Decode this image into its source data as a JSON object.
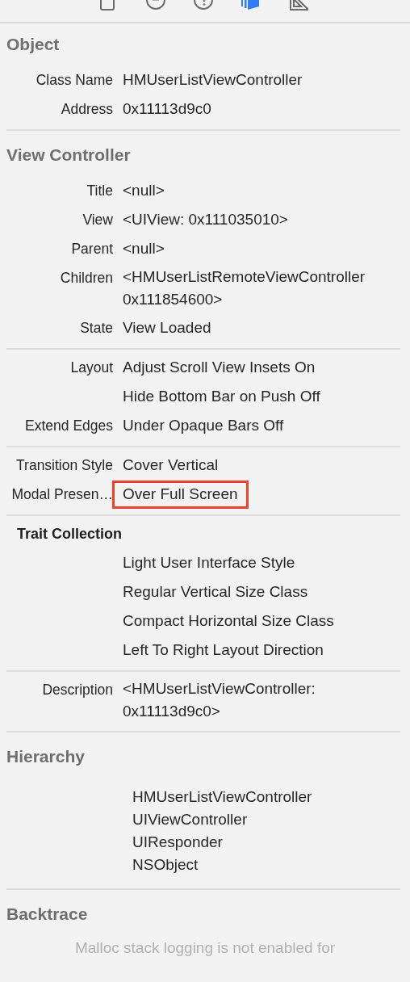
{
  "toolbar": [
    {
      "kind": "file",
      "selected": false
    },
    {
      "kind": "history",
      "selected": false
    },
    {
      "kind": "help",
      "selected": false
    },
    {
      "kind": "identity",
      "selected": true
    },
    {
      "kind": "ruler",
      "selected": false
    }
  ],
  "sections": [
    {
      "title": "Object",
      "groups": [
        {
          "rows": [
            {
              "label": "Class Name",
              "value": "HMUserListViewController",
              "highlighted": false
            },
            {
              "label": "Address",
              "value": "0x11113d9c0",
              "highlighted": false
            }
          ]
        }
      ]
    },
    {
      "title": "View Controller",
      "groups": [
        {
          "rows": [
            {
              "label": "Title",
              "value": "<null>",
              "highlighted": false
            },
            {
              "label": "View",
              "value": "<UIView: 0x111035010>",
              "highlighted": false
            },
            {
              "label": "Parent",
              "value": "<null>",
              "highlighted": false
            },
            {
              "label": "Children",
              "value": "<HMUserListRemoteViewController 0x111854600>",
              "highlighted": false
            },
            {
              "label": "State",
              "value": "View Loaded",
              "highlighted": false
            }
          ]
        },
        {
          "rows": [
            {
              "label": "Layout",
              "value": "Adjust Scroll View Insets On",
              "highlighted": false
            },
            {
              "value": "Hide Bottom Bar on Push Off",
              "highlighted": false
            },
            {
              "label": "Extend Edges",
              "value": "Under Opaque Bars Off",
              "highlighted": false
            }
          ]
        },
        {
          "rows": [
            {
              "label": "Transition Style",
              "value": "Cover Vertical",
              "highlighted": false
            },
            {
              "label": "Modal Presen…",
              "value": "Over Full Screen",
              "highlighted": true
            }
          ]
        },
        {
          "subtitle": "Trait Collection",
          "rows": [
            {
              "value": "Light User Interface Style",
              "highlighted": false
            },
            {
              "value": "Regular Vertical Size Class",
              "highlighted": false
            },
            {
              "value": "Compact Horizontal Size Class",
              "highlighted": false
            },
            {
              "value": "Left To Right Layout Direction",
              "highlighted": false
            }
          ]
        },
        {
          "rows": [
            {
              "label": "Description",
              "value": "<HMUserListViewController: 0x11113d9c0>",
              "highlighted": false
            }
          ]
        }
      ]
    },
    {
      "title": "Hierarchy",
      "items": [
        "HMUserListViewController",
        "UIViewController",
        "UIResponder",
        "NSObject"
      ]
    },
    {
      "title": "Backtrace",
      "message": "Malloc stack logging is not enabled for"
    }
  ]
}
